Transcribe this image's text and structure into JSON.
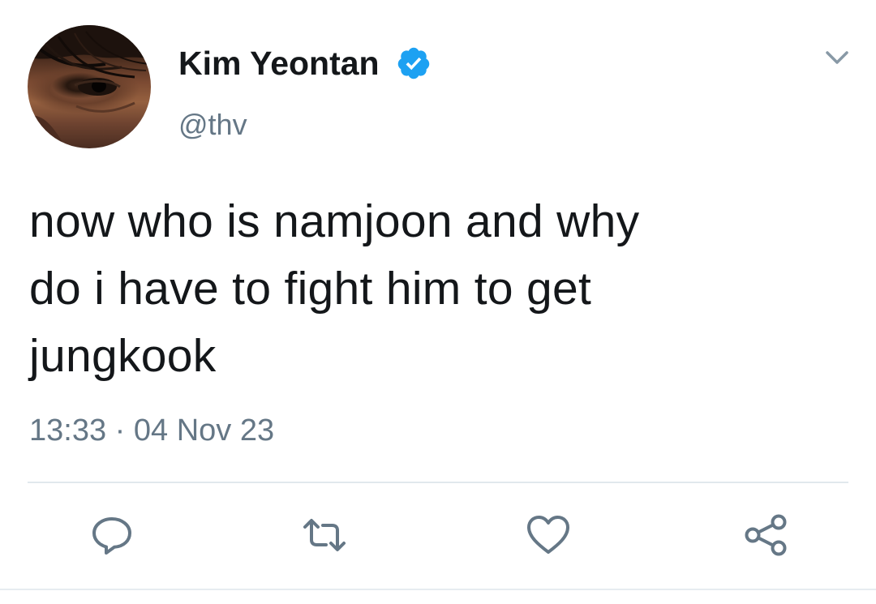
{
  "tweet": {
    "author": {
      "display_name": "Kim Yeontan",
      "handle": "@thv",
      "verified": true
    },
    "text": "now who is namjoon and why\ndo i have to fight him to get\njungkook",
    "timestamp": "13:33 · 04 Nov 23"
  },
  "icons": {
    "verified": "verified-badge-icon",
    "menu": "chevron-down-icon",
    "reply": "reply-bubble-icon",
    "retweet": "retweet-icon",
    "like": "heart-icon",
    "share": "share-icon"
  },
  "colors": {
    "text": "#14171a",
    "secondary_text": "#657786",
    "verified_blue": "#1da1f2",
    "divider": "#e1e8ed"
  }
}
